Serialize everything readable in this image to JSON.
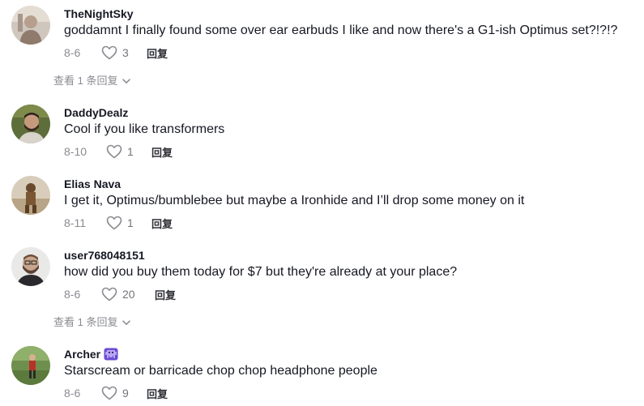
{
  "comments": [
    {
      "username": "TheNightSky",
      "text": "goddamnt I finally found some over ear earbuds I like and now there's a G1-ish Optimus set?!?!?",
      "date": "8-6",
      "likes": "3",
      "reply_label": "回复",
      "view_replies": "查看 1 条回复"
    },
    {
      "username": "DaddyDealz",
      "text": "Cool if you like transformers",
      "date": "8-10",
      "likes": "1",
      "reply_label": "回复"
    },
    {
      "username": "Elias Nava",
      "text": "I get it, Optimus/bumblebee but maybe a Ironhide and I’ll drop some money on it",
      "date": "8-11",
      "likes": "1",
      "reply_label": "回复"
    },
    {
      "username": "user768048151",
      "text": "how did you buy them today for $7 but they're already at your place?",
      "date": "8-6",
      "likes": "20",
      "reply_label": "回复",
      "view_replies": "查看 1 条回复"
    },
    {
      "username": "Archer",
      "username_badge": "alien-monster-icon",
      "text": "Starscream or barricade chop chop headphone people",
      "date": "8-6",
      "likes": "9",
      "reply_label": "回复"
    }
  ],
  "colors": {
    "text": "#161823",
    "meta": "#8a8b91",
    "badge": "#6a4bd4"
  }
}
